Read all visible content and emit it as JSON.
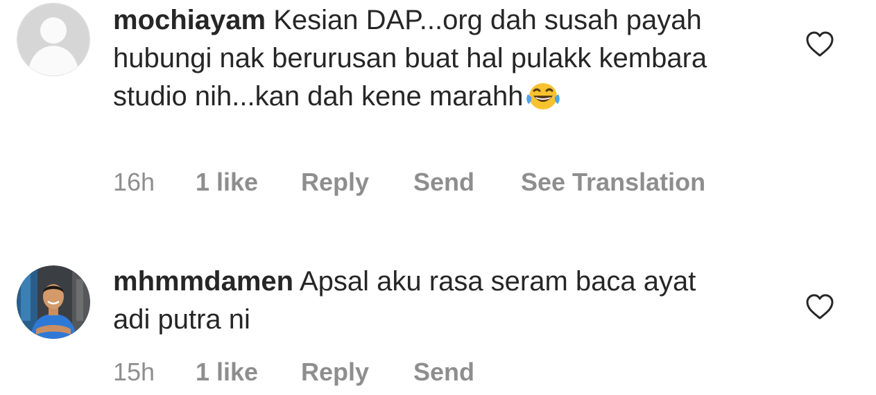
{
  "comments": [
    {
      "username": "mochiayam",
      "text": "Kesian DAP...org dah susah payah hubungi nak berurusan buat hal pulakk kembara studio nih...kan dah kene marahh",
      "emoji": "face-with-tears-of-joy",
      "time": "16h",
      "likes": "1 like",
      "reply_label": "Reply",
      "send_label": "Send",
      "translation_label": "See Translation",
      "avatar": "default-profile-avatar"
    },
    {
      "username": "mhmmdamen",
      "text": "Apsal aku rasa seram baca ayat adi putra ni",
      "time": "15h",
      "likes": "1 like",
      "reply_label": "Reply",
      "send_label": "Send",
      "avatar": "profile-photo-man-blue-shirt"
    }
  ],
  "colors": {
    "text": "#262626",
    "secondary_text": "#8e8e8e",
    "avatar_placeholder": "#dbdbdb",
    "heart_outline": "#262626"
  }
}
